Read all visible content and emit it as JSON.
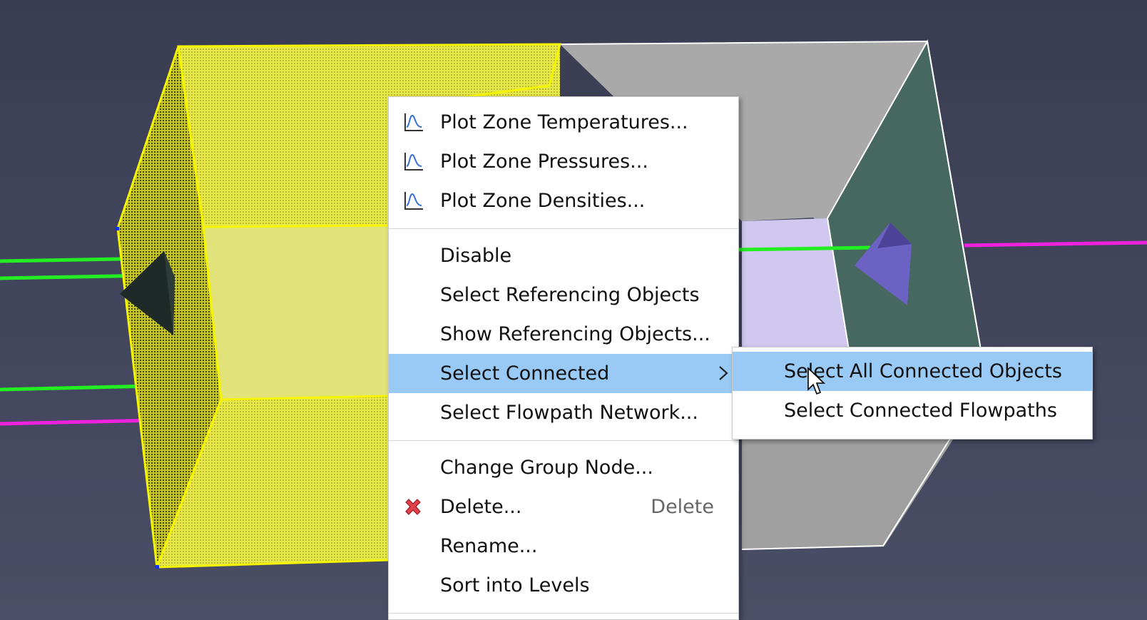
{
  "context_menu": {
    "plot_group": [
      {
        "label": "Plot Zone Temperatures...",
        "icon": "plot-chart-icon"
      },
      {
        "label": "Plot Zone Pressures...",
        "icon": "plot-chart-icon"
      },
      {
        "label": "Plot Zone Densities...",
        "icon": "plot-chart-icon"
      }
    ],
    "select_group": [
      {
        "label": "Disable"
      },
      {
        "label": "Select Referencing Objects"
      },
      {
        "label": "Show Referencing Objects..."
      },
      {
        "label": "Select Connected",
        "has_submenu": true,
        "highlighted": true
      },
      {
        "label": "Select Flowpath Network..."
      }
    ],
    "edit_group": [
      {
        "label": "Change Group Node..."
      },
      {
        "label": "Delete...",
        "shortcut": "Delete",
        "icon": "delete-x-icon"
      },
      {
        "label": "Rename..."
      },
      {
        "label": "Sort into Levels"
      }
    ]
  },
  "submenu": {
    "items": [
      {
        "label": "Select All Connected Objects",
        "highlighted": true
      },
      {
        "label": "Select Connected Flowpaths"
      }
    ]
  },
  "colors": {
    "highlight": "#99c9f5",
    "selection_yellow": "#f0f000",
    "flowpath_green": "#22ee22",
    "flowpath_magenta": "#ee22dd",
    "background": "#40435a"
  }
}
